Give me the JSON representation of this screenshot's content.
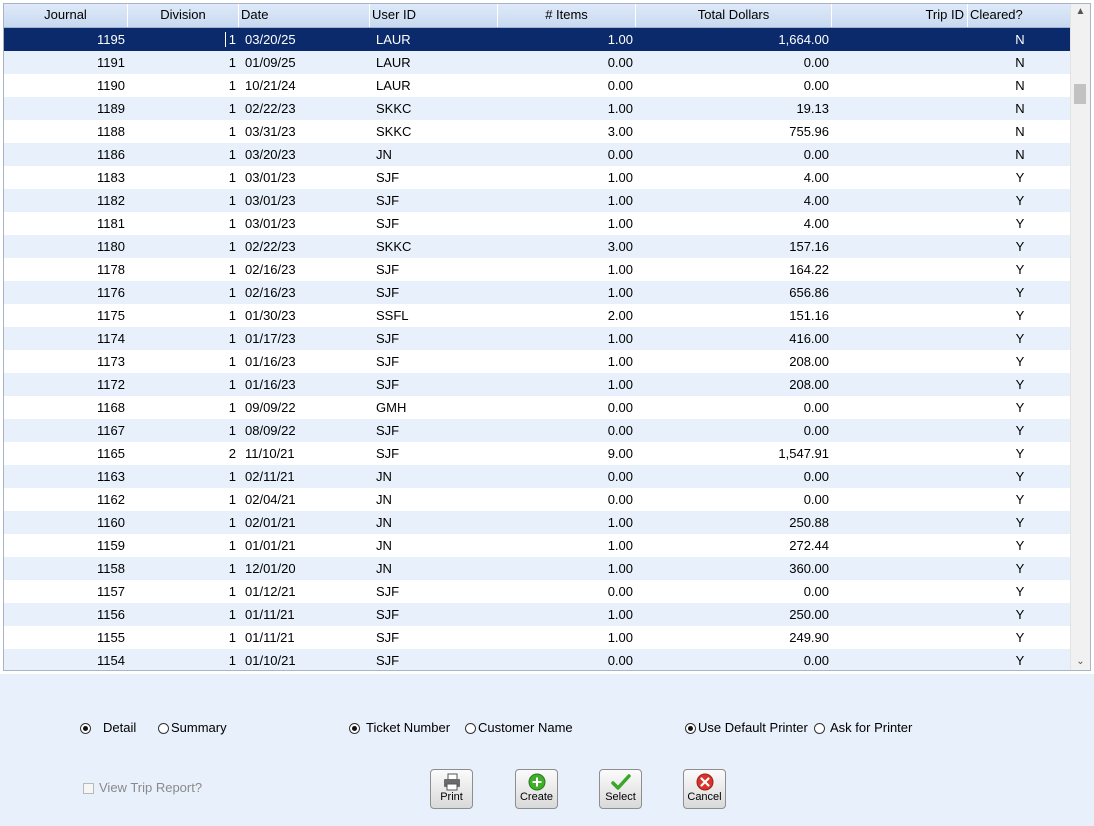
{
  "columns": [
    "Journal",
    "Division",
    "Date",
    "User ID",
    "# Items",
    "Total Dollars",
    "Trip ID",
    "Cleared?"
  ],
  "rows": [
    {
      "journal": "1195",
      "division": "1",
      "date": "03/20/25",
      "user": "LAUR",
      "items": "1.00",
      "total": "1,664.00",
      "trip": "",
      "cleared": "N"
    },
    {
      "journal": "1191",
      "division": "1",
      "date": "01/09/25",
      "user": "LAUR",
      "items": "0.00",
      "total": "0.00",
      "trip": "",
      "cleared": "N"
    },
    {
      "journal": "1190",
      "division": "1",
      "date": "10/21/24",
      "user": "LAUR",
      "items": "0.00",
      "total": "0.00",
      "trip": "",
      "cleared": "N"
    },
    {
      "journal": "1189",
      "division": "1",
      "date": "02/22/23",
      "user": "SKKC",
      "items": "1.00",
      "total": "19.13",
      "trip": "",
      "cleared": "N"
    },
    {
      "journal": "1188",
      "division": "1",
      "date": "03/31/23",
      "user": "SKKC",
      "items": "3.00",
      "total": "755.96",
      "trip": "",
      "cleared": "N"
    },
    {
      "journal": "1186",
      "division": "1",
      "date": "03/20/23",
      "user": "JN",
      "items": "0.00",
      "total": "0.00",
      "trip": "",
      "cleared": "N"
    },
    {
      "journal": "1183",
      "division": "1",
      "date": "03/01/23",
      "user": "SJF",
      "items": "1.00",
      "total": "4.00",
      "trip": "",
      "cleared": "Y"
    },
    {
      "journal": "1182",
      "division": "1",
      "date": "03/01/23",
      "user": "SJF",
      "items": "1.00",
      "total": "4.00",
      "trip": "",
      "cleared": "Y"
    },
    {
      "journal": "1181",
      "division": "1",
      "date": "03/01/23",
      "user": "SJF",
      "items": "1.00",
      "total": "4.00",
      "trip": "",
      "cleared": "Y"
    },
    {
      "journal": "1180",
      "division": "1",
      "date": "02/22/23",
      "user": "SKKC",
      "items": "3.00",
      "total": "157.16",
      "trip": "",
      "cleared": "Y"
    },
    {
      "journal": "1178",
      "division": "1",
      "date": "02/16/23",
      "user": "SJF",
      "items": "1.00",
      "total": "164.22",
      "trip": "",
      "cleared": "Y"
    },
    {
      "journal": "1176",
      "division": "1",
      "date": "02/16/23",
      "user": "SJF",
      "items": "1.00",
      "total": "656.86",
      "trip": "",
      "cleared": "Y"
    },
    {
      "journal": "1175",
      "division": "1",
      "date": "01/30/23",
      "user": "SSFL",
      "items": "2.00",
      "total": "151.16",
      "trip": "",
      "cleared": "Y"
    },
    {
      "journal": "1174",
      "division": "1",
      "date": "01/17/23",
      "user": "SJF",
      "items": "1.00",
      "total": "416.00",
      "trip": "",
      "cleared": "Y"
    },
    {
      "journal": "1173",
      "division": "1",
      "date": "01/16/23",
      "user": "SJF",
      "items": "1.00",
      "total": "208.00",
      "trip": "",
      "cleared": "Y"
    },
    {
      "journal": "1172",
      "division": "1",
      "date": "01/16/23",
      "user": "SJF",
      "items": "1.00",
      "total": "208.00",
      "trip": "",
      "cleared": "Y"
    },
    {
      "journal": "1168",
      "division": "1",
      "date": "09/09/22",
      "user": "GMH",
      "items": "0.00",
      "total": "0.00",
      "trip": "",
      "cleared": "Y"
    },
    {
      "journal": "1167",
      "division": "1",
      "date": "08/09/22",
      "user": "SJF",
      "items": "0.00",
      "total": "0.00",
      "trip": "",
      "cleared": "Y"
    },
    {
      "journal": "1165",
      "division": "2",
      "date": "11/10/21",
      "user": "SJF",
      "items": "9.00",
      "total": "1,547.91",
      "trip": "",
      "cleared": "Y"
    },
    {
      "journal": "1163",
      "division": "1",
      "date": "02/11/21",
      "user": "JN",
      "items": "0.00",
      "total": "0.00",
      "trip": "",
      "cleared": "Y"
    },
    {
      "journal": "1162",
      "division": "1",
      "date": "02/04/21",
      "user": "JN",
      "items": "0.00",
      "total": "0.00",
      "trip": "",
      "cleared": "Y"
    },
    {
      "journal": "1160",
      "division": "1",
      "date": "02/01/21",
      "user": "JN",
      "items": "1.00",
      "total": "250.88",
      "trip": "",
      "cleared": "Y"
    },
    {
      "journal": "1159",
      "division": "1",
      "date": "01/01/21",
      "user": "JN",
      "items": "1.00",
      "total": "272.44",
      "trip": "",
      "cleared": "Y"
    },
    {
      "journal": "1158",
      "division": "1",
      "date": "12/01/20",
      "user": "JN",
      "items": "1.00",
      "total": "360.00",
      "trip": "",
      "cleared": "Y"
    },
    {
      "journal": "1157",
      "division": "1",
      "date": "01/12/21",
      "user": "SJF",
      "items": "0.00",
      "total": "0.00",
      "trip": "",
      "cleared": "Y"
    },
    {
      "journal": "1156",
      "division": "1",
      "date": "01/11/21",
      "user": "SJF",
      "items": "1.00",
      "total": "250.00",
      "trip": "",
      "cleared": "Y"
    },
    {
      "journal": "1155",
      "division": "1",
      "date": "01/11/21",
      "user": "SJF",
      "items": "1.00",
      "total": "249.90",
      "trip": "",
      "cleared": "Y"
    },
    {
      "journal": "1154",
      "division": "1",
      "date": "01/10/21",
      "user": "SJF",
      "items": "0.00",
      "total": "0.00",
      "trip": "",
      "cleared": "Y"
    }
  ],
  "selected_row": 0,
  "options": {
    "detail": {
      "label": "Detail",
      "selected": true
    },
    "summary": {
      "label": "Summary",
      "selected": false
    },
    "ticket_number": {
      "label": "Ticket Number",
      "selected": true
    },
    "customer_name": {
      "label": "Customer Name",
      "selected": false
    },
    "use_default_printer": {
      "label": "Use Default Printer",
      "selected": true
    },
    "ask_for_printer": {
      "label": "Ask for Printer",
      "selected": false
    },
    "view_trip_report": {
      "label": "View Trip Report?",
      "checked": false,
      "enabled": false
    }
  },
  "buttons": {
    "print": "Print",
    "create": "Create",
    "select": "Select",
    "cancel": "Cancel"
  },
  "colors": {
    "selected_row_bg": "#0b2a6b",
    "alt_row_bg": "#e7f0fb",
    "panel_bg": "#e8f0fb"
  },
  "icons": {
    "print": "printer-icon",
    "create": "plus-circle-icon",
    "select": "checkmark-icon",
    "cancel": "x-circle-icon"
  }
}
